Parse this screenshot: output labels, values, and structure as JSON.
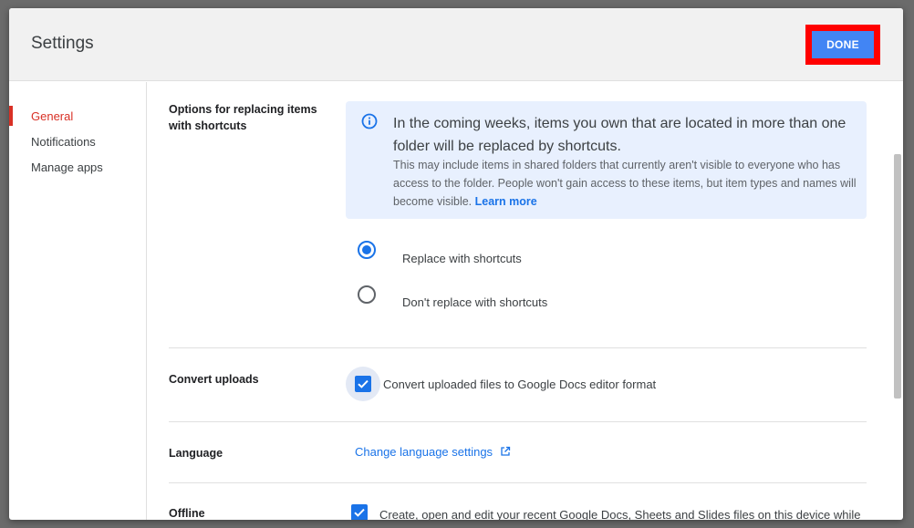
{
  "dialog": {
    "title": "Settings",
    "done_label": "DONE"
  },
  "sidebar": {
    "items": [
      {
        "label": "General",
        "active": true
      },
      {
        "label": "Notifications"
      },
      {
        "label": "Manage apps"
      }
    ]
  },
  "shortcuts": {
    "label": "Options for replacing items with shortcuts",
    "info_heading": "In the coming weeks, items you own that are located in more than one folder will be replaced by shortcuts.",
    "info_body": "This may include items in shared folders that currently aren't visible to everyone who has access to the folder. People won't gain access to these items, but item types and names will become visible.",
    "learn_more": "Learn more",
    "options": [
      {
        "label": "Replace with shortcuts",
        "selected": true
      },
      {
        "label": "Don't replace with shortcuts",
        "selected": false
      }
    ]
  },
  "convert": {
    "label": "Convert uploads",
    "checkbox_label": "Convert uploaded files to Google Docs editor format",
    "checked": true
  },
  "language": {
    "label": "Language",
    "link": "Change language settings"
  },
  "offline": {
    "label": "Offline",
    "checkbox_label": "Create, open and edit your recent Google Docs, Sheets and Slides files on this device while offline",
    "checked": true
  },
  "colors": {
    "accent": "#1a73e8",
    "active_nav": "#d93025",
    "done_button": "#4285f4",
    "highlight": "#ff0000"
  }
}
